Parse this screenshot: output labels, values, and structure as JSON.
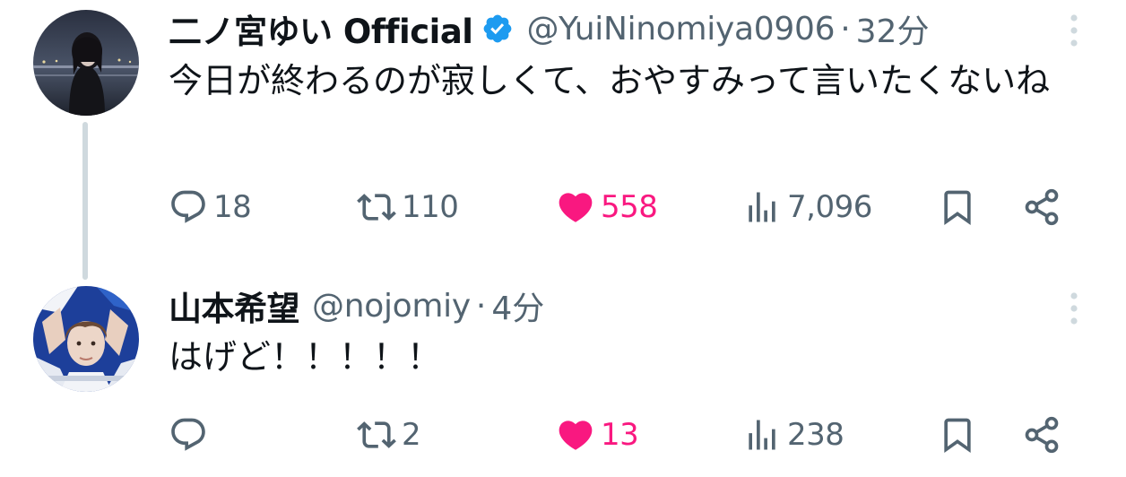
{
  "tweets": [
    {
      "display_name": "二ノ宮ゆい Official",
      "verified": true,
      "handle": "@YuiNinomiya0906",
      "separator": "·",
      "time": "32分",
      "text": "今日が終わるのが寂しくて、おやすみって言いたくないね",
      "replies": "18",
      "retweets": "110",
      "likes": "558",
      "views": "7,096"
    },
    {
      "display_name": "山本希望",
      "verified": false,
      "handle": "@nojomiy",
      "separator": "·",
      "time": "4分",
      "text": "はげど！！！！！",
      "replies": "",
      "retweets": "2",
      "likes": "13",
      "views": "238"
    }
  ],
  "icons": {
    "reply": "speech-bubble-icon",
    "retweet": "retweet-arrows-icon",
    "like": "heart-icon",
    "views": "bar-chart-icon",
    "bookmark": "bookmark-icon",
    "share": "share-nodes-icon",
    "more": "vertical-dots-icon",
    "verified": "verified-badge-icon"
  },
  "colors": {
    "like_active": "#f91880",
    "verified": "#1d9bf0",
    "secondary_text": "#536471",
    "thread_line": "#cfd9de"
  }
}
